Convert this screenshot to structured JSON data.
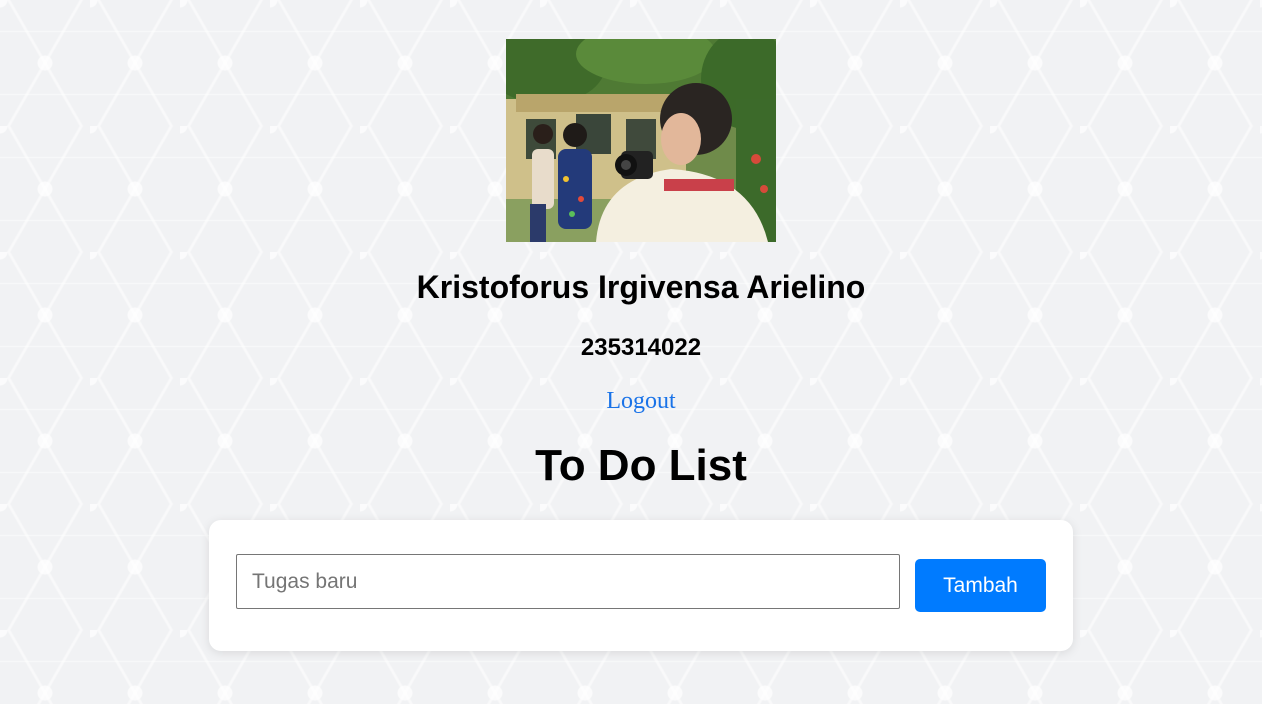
{
  "profile": {
    "name": "Kristoforus Irgivensa Arielino",
    "student_id": "235314022",
    "logout_label": "Logout",
    "photo_alt": "Profile photo"
  },
  "page": {
    "title": "To Do List"
  },
  "todo_form": {
    "input_placeholder": "Tugas baru",
    "input_value": "",
    "add_button_label": "Tambah"
  },
  "colors": {
    "accent": "#007bff",
    "link": "#1a73e8",
    "background": "#f1f2f4"
  }
}
